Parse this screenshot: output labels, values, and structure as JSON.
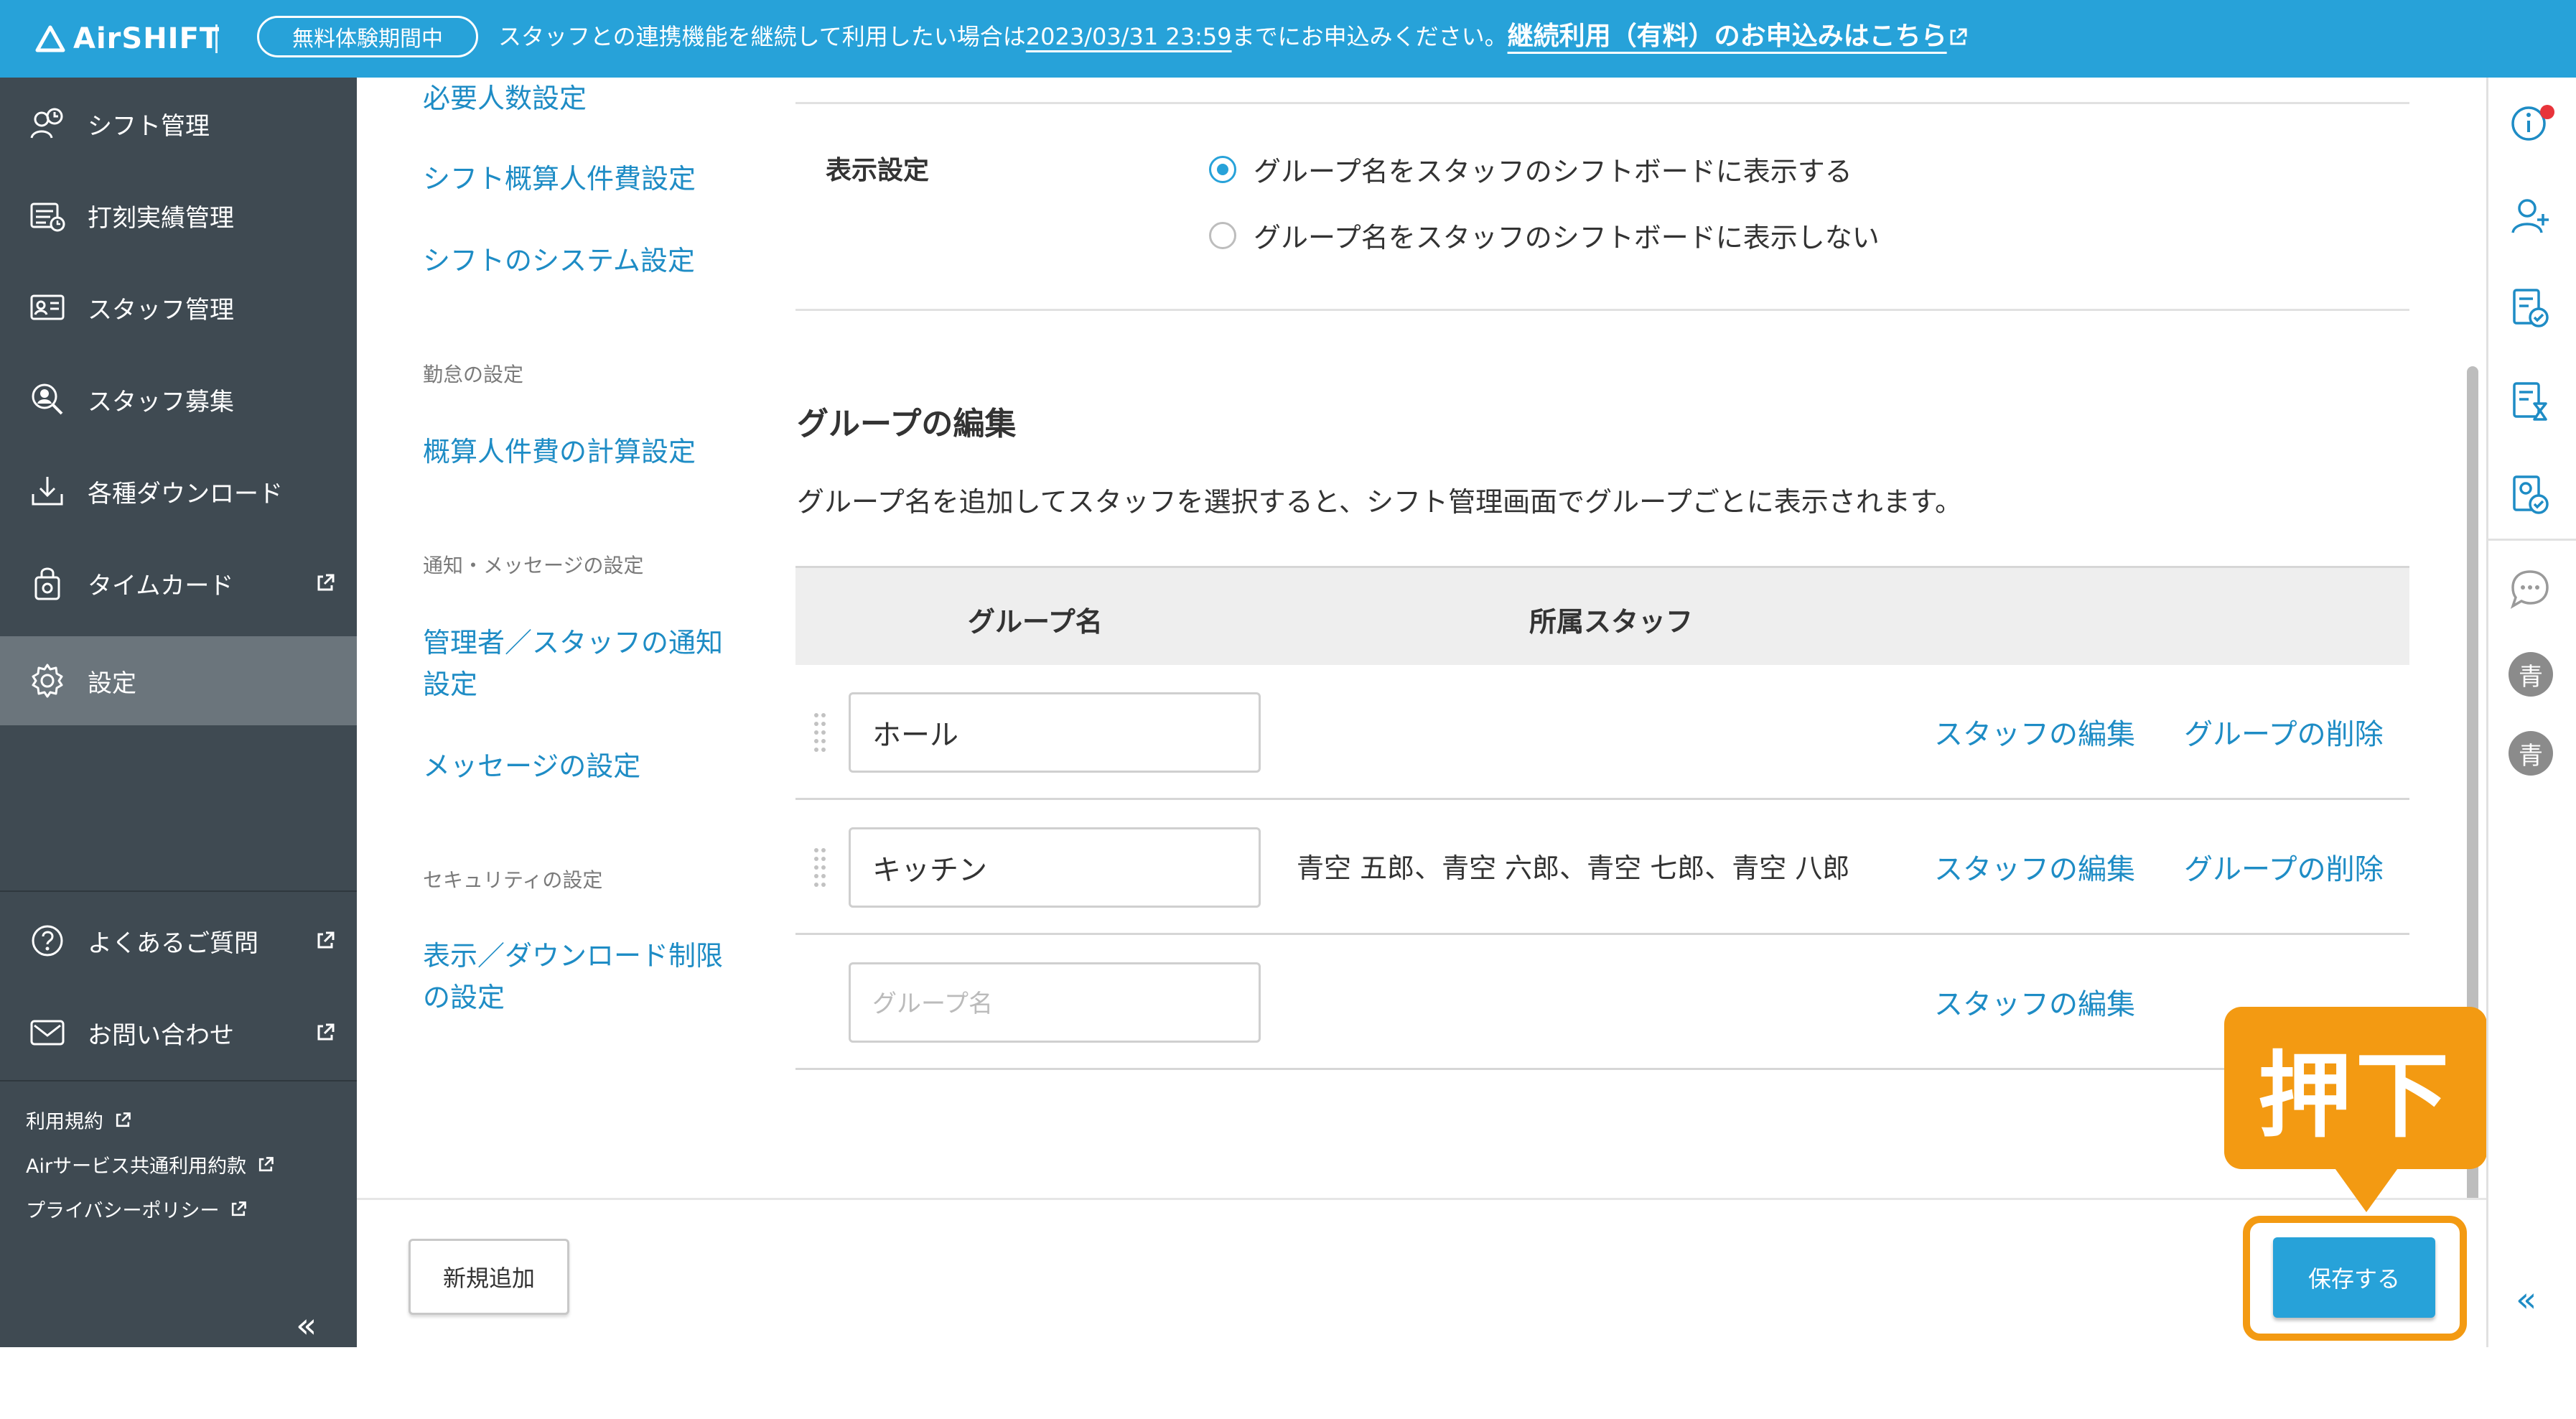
{
  "banner": {
    "brand": "AirSHIFT",
    "trial_badge": "無料体験期間中",
    "notice_prefix": "スタッフとの連携機能を継続して利用したい場合は",
    "deadline": "2023/03/31 23:59",
    "notice_suffix": "までにお申込みください。",
    "continue_link": "継続利用（有料）のお申込みはこちら",
    "bg_color": "#27a2d9"
  },
  "sidebar": {
    "items": [
      {
        "label": "シフト管理",
        "icon": "shift-icon"
      },
      {
        "label": "打刻実績管理",
        "icon": "timecard-record-icon"
      },
      {
        "label": "スタッフ管理",
        "icon": "staff-card-icon"
      },
      {
        "label": "スタッフ募集",
        "icon": "recruit-icon"
      },
      {
        "label": "各種ダウンロード",
        "icon": "download-icon"
      },
      {
        "label": "タイムカード",
        "icon": "timecard-lock-icon",
        "external": true
      },
      {
        "label": "設定",
        "icon": "gear-icon",
        "active": true
      }
    ],
    "support": [
      {
        "label": "よくあるご質問",
        "icon": "question-icon",
        "external": true
      },
      {
        "label": "お問い合わせ",
        "icon": "mail-icon",
        "external": true
      }
    ],
    "legal": [
      "利用規約",
      "Airサービス共通利用約款",
      "プライバシーポリシー"
    ],
    "collapse_label": "«",
    "bg_color": "#3f4a52"
  },
  "submenu": {
    "links_top": [
      "必要人数設定",
      "シフト概算人件費設定",
      "シフトのシステム設定"
    ],
    "attendance_heading": "勤怠の設定",
    "attendance_links": [
      "概算人件費の計算設定"
    ],
    "notify_heading": "通知・メッセージの設定",
    "notify_links": [
      "管理者／スタッフの通知設定",
      "メッセージの設定"
    ],
    "security_heading": "セキュリティの設定",
    "security_links": [
      "表示／ダウンロード制限の設定"
    ]
  },
  "display_settings": {
    "label": "表示設定",
    "options": [
      {
        "label": "グループ名をスタッフのシフトボードに表示する",
        "selected": true
      },
      {
        "label": "グループ名をスタッフのシフトボードに表示しない",
        "selected": false
      }
    ]
  },
  "groups": {
    "title": "グループの編集",
    "description": "グループ名を追加してスタッフを選択すると、シフト管理画面でグループごとに表示されます。",
    "col_name": "グループ名",
    "col_staff": "所属スタッフ",
    "rows": [
      {
        "name": "ホール",
        "staff": "",
        "edit_label": "スタッフの編集",
        "delete_label": "グループの削除"
      },
      {
        "name": "キッチン",
        "staff": "青空 五郎、青空 六郎、青空 七郎、青空 八郎",
        "edit_label": "スタッフの編集",
        "delete_label": "グループの削除"
      }
    ],
    "new_row": {
      "placeholder": "グループ名",
      "edit_label": "スタッフの編集"
    }
  },
  "footer": {
    "add_label": "新規追加",
    "save_label": "保存する",
    "accent_color": "#27a2d9"
  },
  "callout": {
    "text": "押下",
    "color": "#f39a12"
  },
  "rail": {
    "icons": [
      "info-icon",
      "add-user-icon",
      "document-check-icon",
      "document-hourglass-icon",
      "document-clock-icon",
      "chat-icon"
    ],
    "avatars": [
      "青",
      "青"
    ],
    "collapse_label": "«"
  }
}
